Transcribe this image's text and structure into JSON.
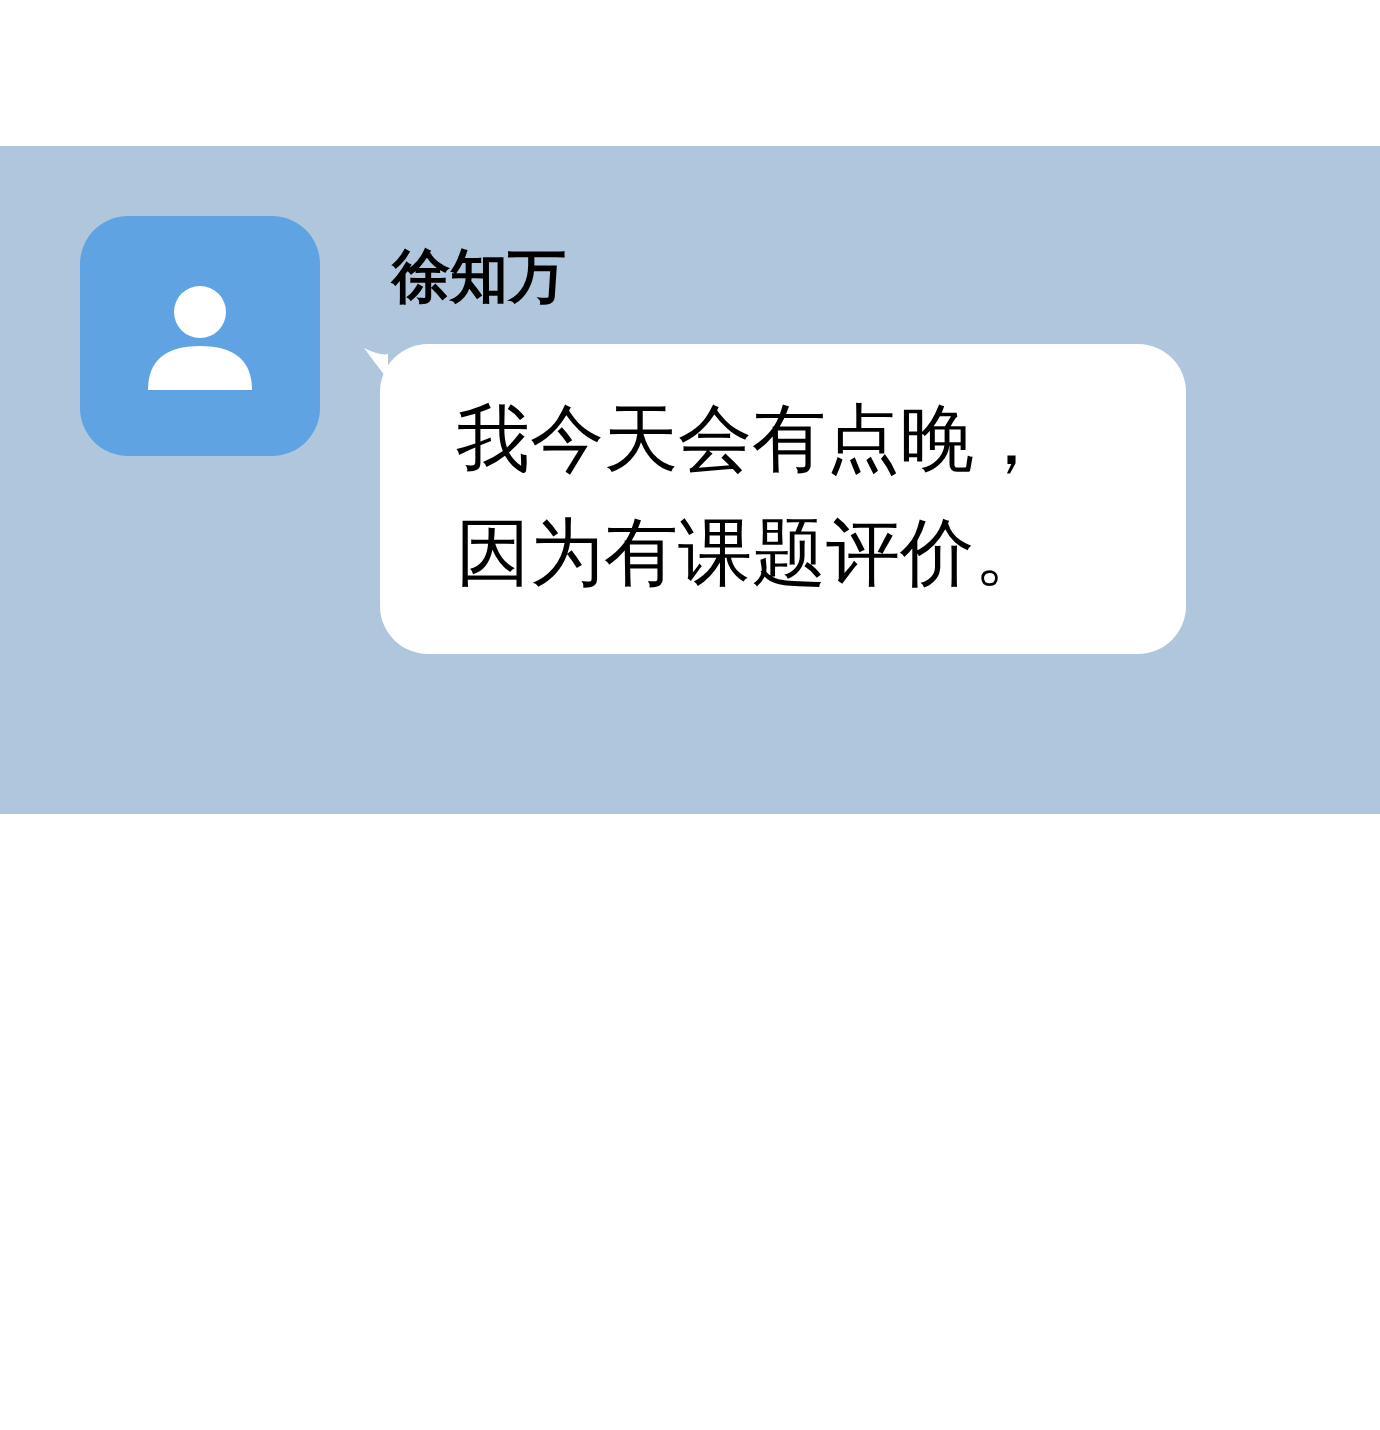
{
  "message": {
    "sender": "徐知万",
    "text": "我今天会有点晚，因为有课题评价。"
  }
}
